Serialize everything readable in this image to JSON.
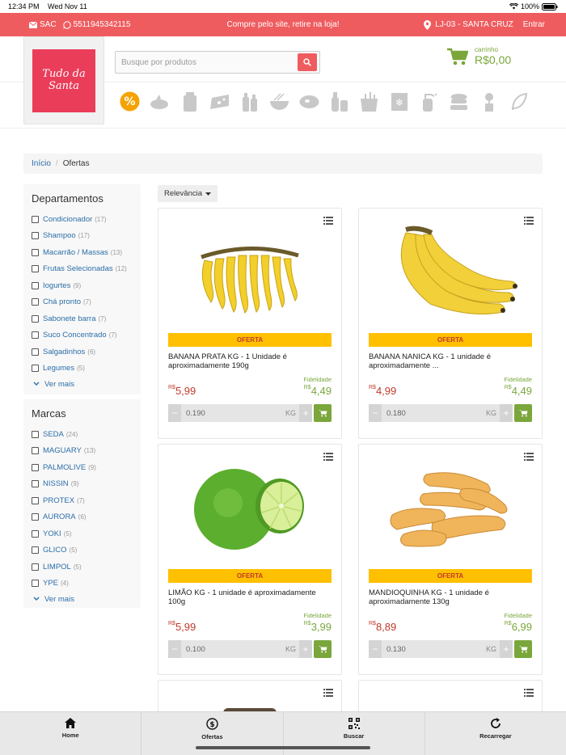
{
  "status": {
    "time": "12:34 PM",
    "date": "Wed Nov 11",
    "battery": "100%"
  },
  "topbar": {
    "sac": "SAC",
    "phone": "5511945342115",
    "promo": "Compre pelo site, retire na loja!",
    "store": "LJ-03 - SANTA CRUZ",
    "login": "Entrar",
    "bg_color": "#ef5c5f"
  },
  "header": {
    "logo_text": "Tudo da Santa",
    "search_placeholder": "Busque por produtos",
    "cart_label": "carrinho",
    "cart_total": "R$0,00"
  },
  "categories": [
    "ofertas-icon",
    "hortifruti-icon",
    "padaria-icon",
    "frios-icon",
    "bebidas-icon",
    "massas-icon",
    "carnes-icon",
    "higiene-icon",
    "mercearia-icon",
    "congelados-icon",
    "limpeza-icon",
    "utilidades-icon",
    "jardinagem-icon",
    "natural-icon"
  ],
  "breadcrumb": {
    "home": "Início",
    "sep": "/",
    "current": "Ofertas"
  },
  "departamentos": {
    "title": "Departamentos",
    "items": [
      {
        "name": "Condicionador",
        "count": "(17)"
      },
      {
        "name": "Shampoo",
        "count": "(17)"
      },
      {
        "name": "Macarrão / Massas",
        "count": "(13)"
      },
      {
        "name": "Frutas Selecionadas",
        "count": "(12)"
      },
      {
        "name": "Iogurtes",
        "count": "(9)"
      },
      {
        "name": "Chá pronto",
        "count": "(7)"
      },
      {
        "name": "Sabonete barra",
        "count": "(7)"
      },
      {
        "name": "Suco Concentrado",
        "count": "(7)"
      },
      {
        "name": "Salgadinhos",
        "count": "(6)"
      },
      {
        "name": "Legumes",
        "count": "(5)"
      }
    ],
    "more": "Ver mais"
  },
  "marcas": {
    "title": "Marcas",
    "items": [
      {
        "name": "SEDA",
        "count": "(24)"
      },
      {
        "name": "MAGUARY",
        "count": "(13)"
      },
      {
        "name": "PALMOLIVE",
        "count": "(9)"
      },
      {
        "name": "NISSIN",
        "count": "(9)"
      },
      {
        "name": "PROTEX",
        "count": "(7)"
      },
      {
        "name": "AURORA",
        "count": "(6)"
      },
      {
        "name": "YOKI",
        "count": "(5)"
      },
      {
        "name": "GLICO",
        "count": "(5)"
      },
      {
        "name": "LIMPOL",
        "count": "(5)"
      },
      {
        "name": "YPE",
        "count": "(4)"
      }
    ],
    "more": "Ver mais"
  },
  "sort": {
    "label": "Relevância"
  },
  "products": [
    {
      "badge": "OFERTA",
      "title": "BANANA PRATA KG - 1 Unidade é aproximadamente 190g",
      "fid_label": "Fidelidade",
      "currency": "R$",
      "price": "5,99",
      "fid_price": "4,49",
      "qty": "0.190",
      "unit": "KG",
      "image": "banana-prata"
    },
    {
      "badge": "OFERTA",
      "title": "BANANA NANICA KG - 1 unidade é aproximadamente ...",
      "fid_label": "Fidelidade",
      "currency": "R$",
      "price": "4,99",
      "fid_price": "4,49",
      "qty": "0.180",
      "unit": "KG",
      "image": "banana-nanica"
    },
    {
      "badge": "OFERTA",
      "title": "LIMÃO KG - 1 unidade é aproximadamente 100g",
      "fid_label": "Fidelidade",
      "currency": "R$",
      "price": "5,99",
      "fid_price": "3,99",
      "qty": "0.100",
      "unit": "KG",
      "image": "limao"
    },
    {
      "badge": "OFERTA",
      "title": "MANDIOQUINHA KG - 1 unidade é aproximadamente 130g",
      "fid_label": "Fidelidade",
      "currency": "R$",
      "price": "8,89",
      "fid_price": "6,99",
      "qty": "0.130",
      "unit": "KG",
      "image": "mandioquinha"
    }
  ],
  "tabs": [
    {
      "label": "Home",
      "icon": "home-icon"
    },
    {
      "label": "Ofertas",
      "icon": "dollar-icon"
    },
    {
      "label": "Buscar",
      "icon": "qrcode-icon"
    },
    {
      "label": "Recarregar",
      "icon": "reload-icon"
    }
  ]
}
